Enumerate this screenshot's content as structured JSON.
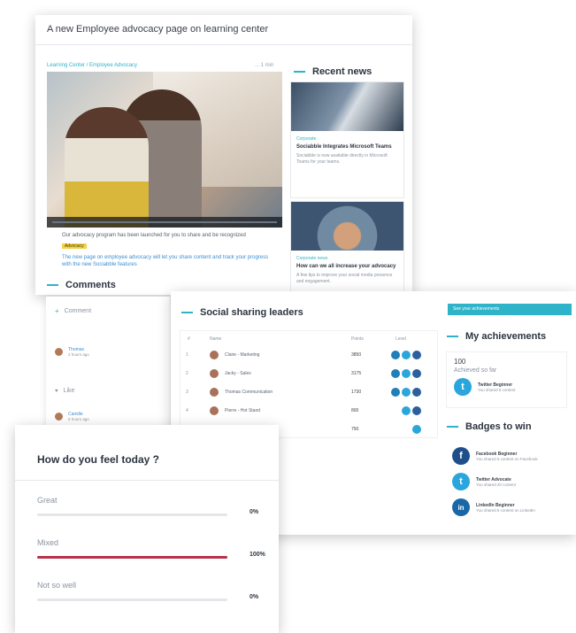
{
  "main_page": {
    "title": "A new Employee advocacy page on learning center",
    "breadcrumb": "Learning Center / Employee Advocacy",
    "video_meta": "... 1 min",
    "caption": "Our advocacy program has been launched for you to share and be recognized",
    "tag": "Advocacy",
    "link_text": "The new page on employee advocacy will let you share content and track your progress with the new Sociabble features",
    "comments_title": "Comments",
    "recent_news_title": "Recent news",
    "news": [
      {
        "category": "Corporate",
        "headline": "Sociabble Integrates Microsoft Teams",
        "text": "Sociabble is now available directly in Microsoft Teams for your teams."
      },
      {
        "category": "Corporate news",
        "headline": "How can we all increase your advocacy",
        "text": "A few tips to improve your social media presence and engagement."
      }
    ]
  },
  "comments_panel": {
    "input_placeholder": "Comment",
    "items": [
      {
        "name": "Thomas",
        "meta": "2 hours ago"
      },
      {
        "name": "Camille",
        "meta": "5 hours ago"
      }
    ],
    "like_label": "Like"
  },
  "sharing": {
    "title": "Social sharing leaders",
    "banner": "See your achievements",
    "columns": {
      "rank": "#",
      "name": "Name",
      "points": "Points",
      "level": "Level"
    },
    "rows": [
      {
        "rank": "1",
        "name": "Claire - Marketing",
        "points": "3850"
      },
      {
        "rank": "2",
        "name": "Jacky - Sales",
        "points": "3175"
      },
      {
        "rank": "3",
        "name": "Thomas Communication",
        "points": "1730"
      },
      {
        "rank": "4",
        "name": "Pierre - Hot Stand",
        "points": "800"
      },
      {
        "rank": "5",
        "name": "",
        "points": "750"
      }
    ],
    "achievements_title": "My achievements",
    "achievement_count": "100",
    "achievement_label": "Achieved so far",
    "achievement_badge": {
      "name": "Twitter Beginner",
      "desc": "You shared 5 content"
    },
    "badges_title": "Badges to win",
    "badges": [
      {
        "icon": "facebook-icon",
        "symbol": "f",
        "name": "Facebook Beginner",
        "desc": "You shared 5 content on Facebook"
      },
      {
        "icon": "twitter-icon",
        "symbol": "t",
        "name": "Twitter Advocate",
        "desc": "You shared 20 content"
      },
      {
        "icon": "linkedin-icon",
        "symbol": "in",
        "name": "LinkedIn Beginner",
        "desc": "You shared 5 content on LinkedIn"
      }
    ]
  },
  "mood_poll": {
    "title": "How do you feel today ?",
    "options": [
      {
        "label": "Great",
        "percent_text": "0%",
        "value": 0
      },
      {
        "label": "Mixed",
        "percent_text": "100%",
        "value": 100
      },
      {
        "label": "Not so well",
        "percent_text": "0%",
        "value": 0
      }
    ],
    "accent_color": "#b6324a"
  },
  "colors": {
    "accent": "#2fb3c9"
  }
}
